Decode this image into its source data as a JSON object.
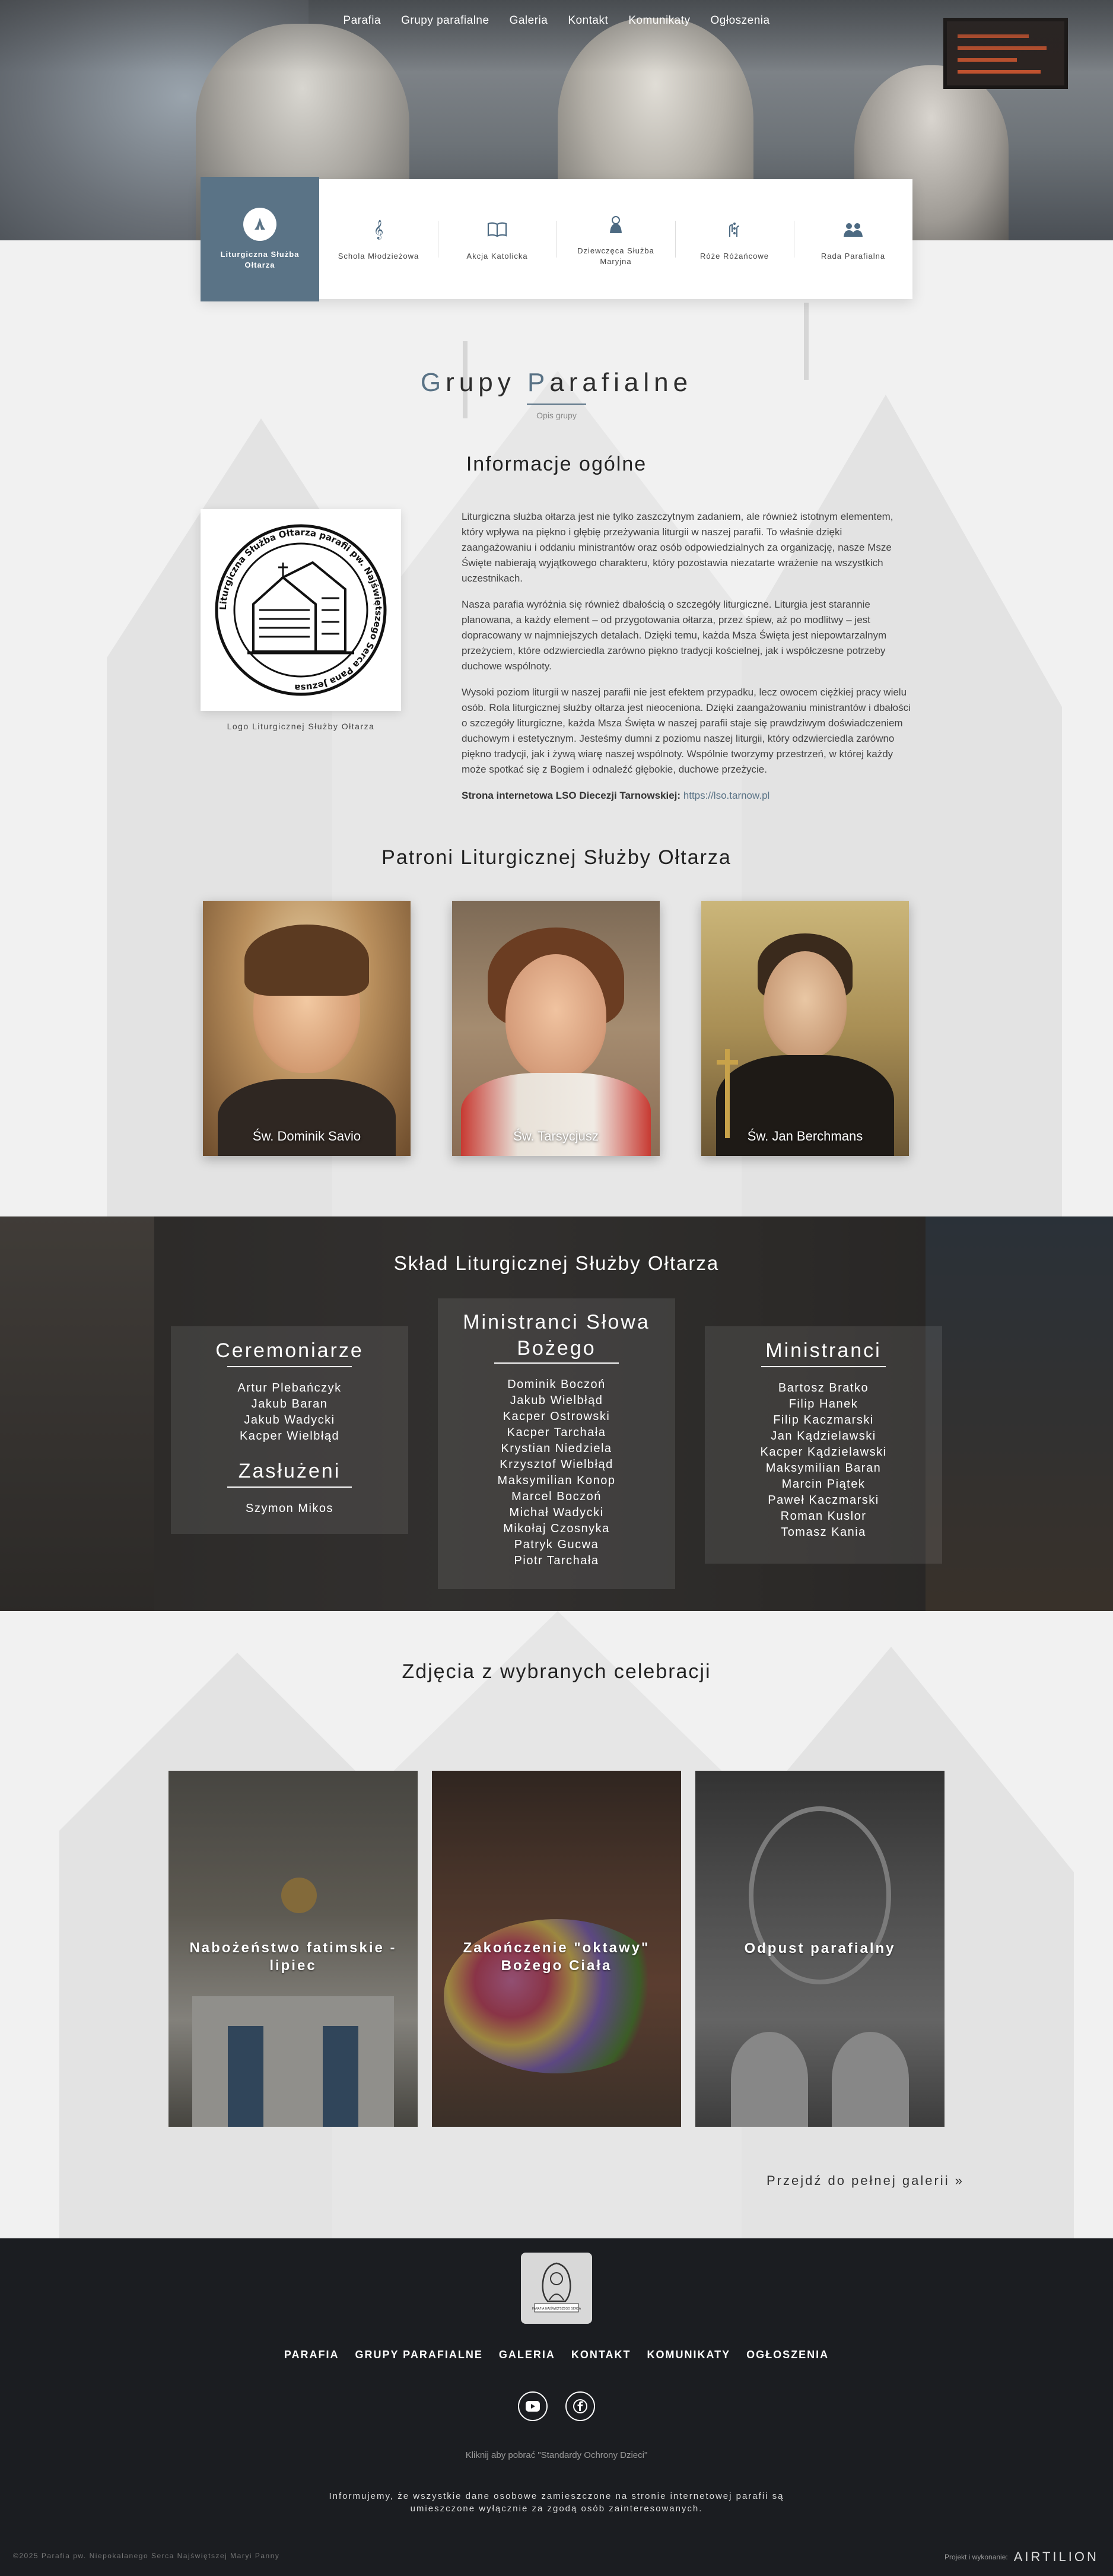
{
  "nav": [
    "Parafia",
    "Grupy parafialne",
    "Galeria",
    "Kontakt",
    "Komunikaty",
    "Ogłoszenia"
  ],
  "tabs": [
    {
      "label": "Liturgiczna Służba Ołtarza",
      "icon": "praying-hands-icon",
      "active": true
    },
    {
      "label": "Schola Młodzieżowa",
      "icon": "music-note-icon",
      "active": false
    },
    {
      "label": "Akcja Katolicka",
      "icon": "open-book-icon",
      "active": false
    },
    {
      "label": "Dziewczęca Służba Maryjna",
      "icon": "mary-icon",
      "active": false
    },
    {
      "label": "Róże Różańcowe",
      "icon": "rosary-hands-icon",
      "active": false
    },
    {
      "label": "Rada Parafialna",
      "icon": "people-group-icon",
      "active": false
    }
  ],
  "section": {
    "title_first": "G",
    "title_rest1": "rupy ",
    "title_accent2": "P",
    "title_rest2": "arafialne",
    "subtitle": "Opis grupy"
  },
  "info": {
    "heading": "Informacje ogólne",
    "logo_caption": "Logo Liturgicznej Służby Ołtarza",
    "logo_ring_text": "Liturgiczna Służba Ołtarza parafii pw. Najświętszego Serca Pana Jezusa",
    "paragraphs": [
      "Liturgiczna służba ołtarza jest nie tylko zaszczytnym zadaniem, ale również istotnym elementem, który wpływa na piękno i głębię przeżywania liturgii w naszej parafii. To właśnie dzięki zaangażowaniu i oddaniu ministrantów oraz osób odpowiedzialnych za organizację, nasze Msze Święte nabierają wyjątkowego charakteru, który pozostawia niezatarte wrażenie na wszystkich uczestnikach.",
      "Nasza parafia wyróżnia się również dbałością o szczegóły liturgiczne. Liturgia jest starannie planowana, a każdy element – od przygotowania ołtarza, przez śpiew, aż po modlitwy – jest dopracowany w najmniejszych detalach. Dzięki temu, każda Msza Święta jest niepowtarzalnym przeżyciem, które odzwierciedla zarówno piękno tradycji kościelnej, jak i współczesne potrzeby duchowe wspólnoty.",
      "Wysoki poziom liturgii w naszej parafii nie jest efektem przypadku, lecz owocem ciężkiej pracy wielu osób. Rola liturgicznej służby ołtarza jest nieoceniona. Dzięki zaangażowaniu ministrantów i dbałości o szczegóły liturgiczne, każda Msza Święta w naszej parafii staje się prawdziwym doświadczeniem duchowym i estetycznym. Jesteśmy dumni z poziomu naszej liturgii, który odzwierciedla zarówno piękno tradycji, jak i żywą wiarę naszej wspólnoty. Wspólnie tworzymy przestrzeń, w której każdy może spotkać się z Bogiem i odnaleźć głębokie, duchowe przeżycie."
    ],
    "website_label": "Strona internetowa LSO Diecezji Tarnowskiej:",
    "website_link": "https://lso.tarnow.pl"
  },
  "patrons": {
    "heading": "Patroni Liturgicznej Służby Ołtarza",
    "items": [
      "Św. Dominik Savio",
      "Św. Tarsycjusz",
      "Św. Jan Berchmans"
    ]
  },
  "sklad": {
    "heading": "Skład Liturgicznej Służby Ołtarza",
    "ceremoniarze": {
      "title": "Ceremoniarze",
      "names": [
        "Artur Plebańczyk",
        "Jakub Baran",
        "Jakub Wadycki",
        "Kacper Wielbłąd"
      ]
    },
    "zasluzeni": {
      "title": "Zasłużeni",
      "names": [
        "Szymon Mikos"
      ]
    },
    "slowa": {
      "title_line1": "Ministranci Słowa",
      "title_line2": "Bożego",
      "names": [
        "Dominik Boczoń",
        "Jakub Wielbłąd",
        "Kacper Ostrowski",
        "Kacper Tarchała",
        "Krystian Niedziela",
        "Krzysztof Wielbłąd",
        "Maksymilian Konop",
        "Marcel Boczoń",
        "Michał Wadycki",
        "Mikołaj Czosnyka",
        "Patryk Gucwa",
        "Piotr Tarchała"
      ]
    },
    "ministranci": {
      "title": "Ministranci",
      "names": [
        "Bartosz Bratko",
        "Filip Hanek",
        "Filip Kaczmarski",
        "Jan Kądzielawski",
        "Kacper Kądzielawski",
        "Maksymilian Baran",
        "Marcin Piątek",
        "Paweł Kaczmarski",
        "Roman Kuslor",
        "Tomasz Kania"
      ]
    }
  },
  "gallery": {
    "heading": "Zdjęcia z wybranych celebracji",
    "items": [
      "Nabożeństwo fatimskie - lipiec",
      "Zakończenie \"oktawy\" Bożego Ciała",
      "Odpust parafialny"
    ],
    "more_label": "Przejdź do pełnej galerii",
    "more_icon": "double-chevron-right-icon"
  },
  "footer": {
    "nav": [
      "PARAFIA",
      "GRUPY PARAFIALNE",
      "GALERIA",
      "KONTAKT",
      "KOMUNIKATY",
      "OGŁOSZENIA"
    ],
    "logo_text": "PARAFIA NAJŚWIĘTSZEGO SERCA",
    "social": [
      "youtube-icon",
      "facebook-icon"
    ],
    "standards": "Kliknij aby pobrać \"Standardy Ochrony Dzieci\"",
    "info_line1": "Informujemy, że wszystkie dane osobowe zamieszczone na stronie internetowej parafii są",
    "info_line2": "umieszczone wyłącznie za zgodą osób zainteresowanych.",
    "copyright": "©2025 Parafia pw. Niepokalanego Serca Najświętszej Maryi Panny",
    "made_by": "Projekt i wykonanie:",
    "brand": "AIRTILION"
  },
  "colors": {
    "accent": "#5a7386",
    "footer_bg": "#1b1d21",
    "section_bg": "#f1f1f1"
  }
}
